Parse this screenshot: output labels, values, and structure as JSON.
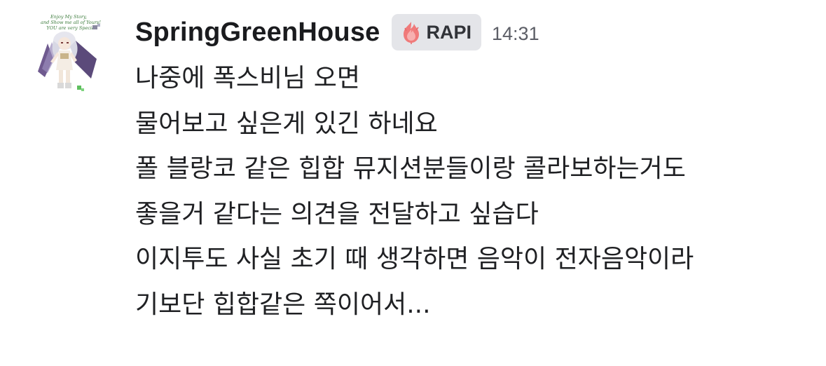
{
  "message": {
    "author": "SpringGreenHouse",
    "tag": {
      "label": "RAPI",
      "icon": "flame-icon",
      "icon_color": "#f07a7a"
    },
    "timestamp": "14:31",
    "avatar_text": "Enjoy My Story, and show me all of Yours! YOU are very Special!",
    "lines": [
      "나중에 폭스비님 오면",
      "물어보고 싶은게 있긴 하네요",
      "폴 블랑코 같은 힙합 뮤지션분들이랑 콜라보하는거도",
      "좋을거 같다는 의견을 전달하고 싶습다",
      "이지투도 사실 초기 때 생각하면 음악이 전자음악이라",
      "기보단 힙합같은 쪽이어서..."
    ]
  },
  "colors": {
    "background": "#ffffff",
    "text": "#1f2023",
    "tag_background": "#e4e5e9",
    "timestamp": "#5c5e66"
  }
}
